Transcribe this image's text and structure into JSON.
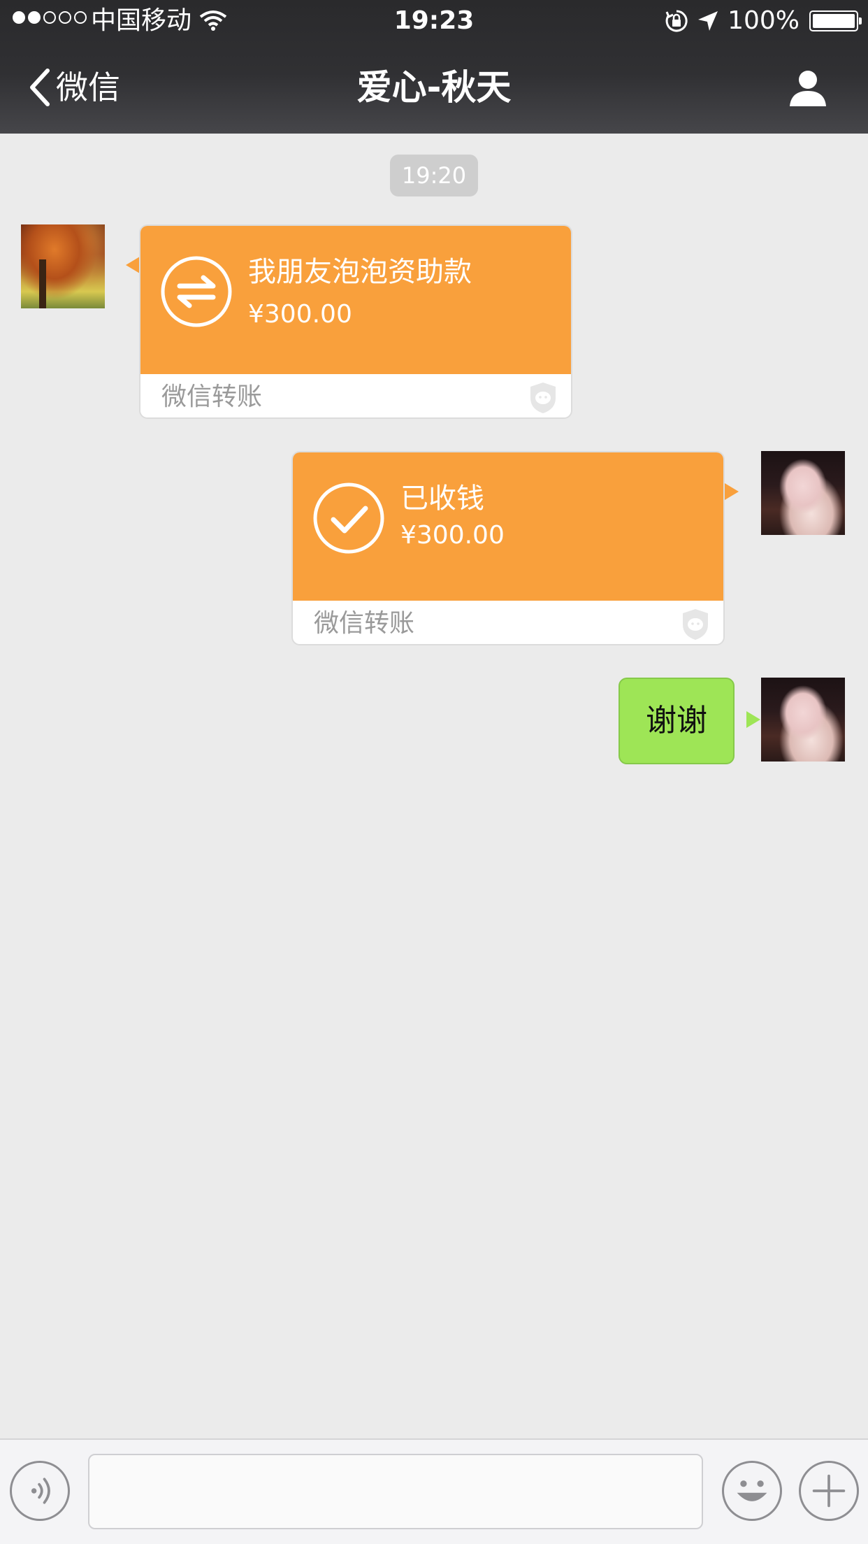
{
  "status_bar": {
    "carrier": "中国移动",
    "time": "19:23",
    "battery": "100%",
    "signal_bars_filled": 2,
    "signal_bars_total": 5
  },
  "nav": {
    "back_label": "微信",
    "title": "爱心-秋天",
    "back_icon": "chevron-left-icon",
    "profile_icon": "person-icon"
  },
  "chat": {
    "timestamp": "19:20",
    "messages": [
      {
        "sender": "other",
        "type": "transfer",
        "text": "我朋友泡泡资助款",
        "amount": "¥300.00",
        "footer": "微信转账",
        "icon": "transfer-arrows-icon"
      },
      {
        "sender": "self",
        "type": "transfer",
        "text": "已收钱",
        "amount": "¥300.00",
        "footer": "微信转账",
        "icon": "check-icon"
      },
      {
        "sender": "self",
        "type": "text",
        "text": "谢谢"
      }
    ]
  },
  "input_bar": {
    "placeholder": "",
    "voice_icon": "voice-icon",
    "emoji_icon": "emoji-icon",
    "more_icon": "plus-icon"
  },
  "colors": {
    "header_bg": "#2f2f31",
    "chat_bg": "#ebebeb",
    "transfer_orange": "#f9a03c",
    "text_bubble_green": "#9ee556",
    "timestamp_bg": "#cecece"
  }
}
